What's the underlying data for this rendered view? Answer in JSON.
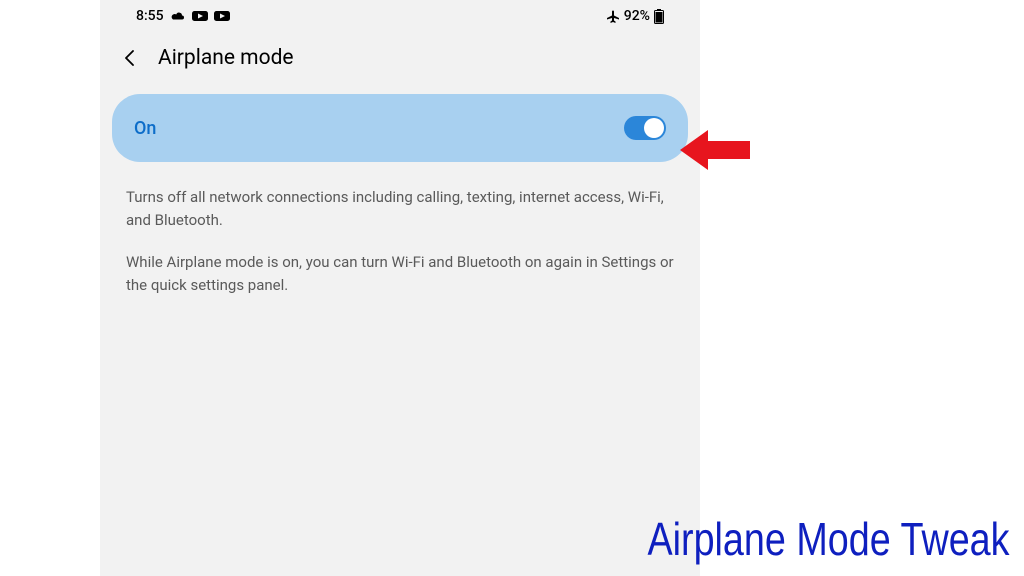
{
  "status_bar": {
    "time": "8:55",
    "battery_text": "92%"
  },
  "header": {
    "title": "Airplane mode"
  },
  "toggle": {
    "label": "On",
    "state": "on"
  },
  "description": {
    "para1": "Turns off all network connections including calling, texting, internet access, Wi-Fi, and Bluetooth.",
    "para2": "While Airplane mode is on, you can turn Wi-Fi and Bluetooth on again in Settings or the quick settings panel."
  },
  "annotation": {
    "caption": "Airplane Mode Tweak"
  }
}
